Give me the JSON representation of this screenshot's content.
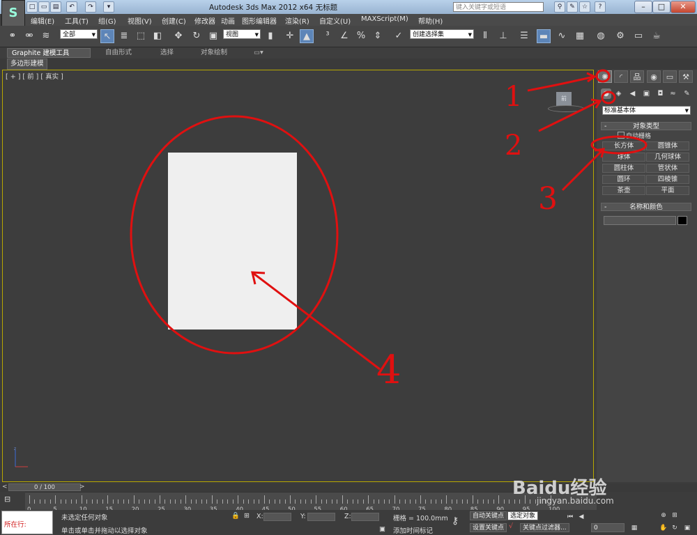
{
  "window": {
    "title": "Autodesk 3ds Max  2012 x64      无标题",
    "search_placeholder": "键入关键字或短语"
  },
  "menu": [
    "编辑(E)",
    "工具(T)",
    "组(G)",
    "视图(V)",
    "创建(C)",
    "修改器",
    "动画",
    "图形编辑器",
    "渲染(R)",
    "自定义(U)",
    "MAXScript(M)",
    "帮助(H)"
  ],
  "toolbar": {
    "selection_filter": "全部",
    "ref_coord": "视图",
    "named_selection": "创建选择集"
  },
  "ribbon": {
    "tabs": [
      "Graphite 建模工具",
      "自由形式",
      "选择",
      "对象绘制"
    ],
    "subtab": "多边形建模"
  },
  "viewport": {
    "label": "[ + ] [ 前 ] [ 真实 ]",
    "viewcube_label": "前"
  },
  "command_panel": {
    "category": "标准基本体",
    "object_type_title": "对象类型",
    "autogrid": "自动栅格",
    "buttons": [
      "长方体",
      "圆锥体",
      "球体",
      "几何球体",
      "圆柱体",
      "管状体",
      "圆环",
      "四棱锥",
      "茶壶",
      "平面"
    ],
    "name_color_title": "名称和颜色"
  },
  "timeline": {
    "frame": "0 / 100",
    "ticks": [
      "0",
      "5",
      "10",
      "15",
      "20",
      "25",
      "30",
      "35",
      "40",
      "45",
      "50",
      "55",
      "60",
      "65",
      "70",
      "75",
      "80",
      "85",
      "90",
      "95",
      "100"
    ]
  },
  "status": {
    "maxscript": "所在行:",
    "selection": "未选定任何对象",
    "prompt": "单击或单击并拖动以选择对象",
    "x_label": "X:",
    "y_label": "Y:",
    "z_label": "Z:",
    "grid": "栅格 = 100.0mm",
    "add_time_tag": "添加时间标记",
    "auto_key": "自动关键点",
    "selected_obj": "选定对象",
    "set_key": "设置关键点",
    "key_filters": "关键点过滤器...",
    "frame_field": "0"
  },
  "annotations": [
    "1",
    "2",
    "3",
    "4"
  ],
  "watermark": {
    "brand": "Baidu经验",
    "url": "jingyan.baidu.com"
  },
  "colors": {
    "annotation": "#e01010",
    "viewport_border": "#b8a800",
    "active_tool": "#5d85b8"
  }
}
